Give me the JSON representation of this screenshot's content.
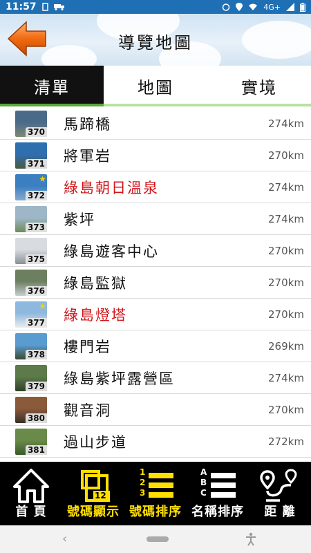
{
  "status": {
    "time": "11:57",
    "network": "4G+"
  },
  "header": {
    "title": "導覽地圖"
  },
  "tabs": [
    {
      "label": "清單",
      "active": true
    },
    {
      "label": "地圖",
      "active": false
    },
    {
      "label": "實境",
      "active": false
    }
  ],
  "list": [
    {
      "num": "370",
      "name": "馬蹄橋",
      "dist": "274km",
      "highlight": false,
      "star": false,
      "thumb": [
        "#4a6a8a",
        "#7f8a70"
      ]
    },
    {
      "num": "371",
      "name": "將軍岩",
      "dist": "270km",
      "highlight": false,
      "star": false,
      "thumb": [
        "#2f6fb0",
        "#4a5a40"
      ]
    },
    {
      "num": "372",
      "name": "綠島朝日溫泉",
      "dist": "274km",
      "highlight": true,
      "star": true,
      "thumb": [
        "#3b7fc0",
        "#88aacc"
      ]
    },
    {
      "num": "373",
      "name": "紫坪",
      "dist": "274km",
      "highlight": false,
      "star": false,
      "thumb": [
        "#9db7c8",
        "#6d8a5a"
      ]
    },
    {
      "num": "375",
      "name": "綠島遊客中心",
      "dist": "270km",
      "highlight": false,
      "star": false,
      "thumb": [
        "#d8dce0",
        "#8a8f96"
      ]
    },
    {
      "num": "376",
      "name": "綠島監獄",
      "dist": "270km",
      "highlight": false,
      "star": false,
      "thumb": [
        "#6c8060",
        "#c9ccd0"
      ]
    },
    {
      "num": "377",
      "name": "綠島燈塔",
      "dist": "270km",
      "highlight": true,
      "star": true,
      "thumb": [
        "#8fb8de",
        "#e8eef2"
      ]
    },
    {
      "num": "378",
      "name": "樓門岩",
      "dist": "269km",
      "highlight": false,
      "star": false,
      "thumb": [
        "#5a9bd0",
        "#3a4a30"
      ]
    },
    {
      "num": "379",
      "name": "綠島紫坪露營區",
      "dist": "274km",
      "highlight": false,
      "star": false,
      "thumb": [
        "#5c7a4a",
        "#2f3f2a"
      ]
    },
    {
      "num": "380",
      "name": "觀音洞",
      "dist": "270km",
      "highlight": false,
      "star": false,
      "thumb": [
        "#8a5a3a",
        "#3a3028"
      ]
    },
    {
      "num": "381",
      "name": "過山步道",
      "dist": "272km",
      "highlight": false,
      "star": false,
      "thumb": [
        "#6a8a4a",
        "#3a5a2a"
      ]
    }
  ],
  "bottom": {
    "home": "首 頁",
    "show_num": "號碼顯示",
    "num_sort": "號碼排序",
    "name_sort": "名稱排序",
    "distance": "距 離",
    "num_badge": "12",
    "abc": [
      "A",
      "B",
      "C"
    ],
    "n123": [
      "1",
      "2",
      "3"
    ]
  },
  "colors": {
    "highlight": "#d1151a",
    "accent_yellow": "#ffe000",
    "tab_green": "#5aa83a"
  }
}
